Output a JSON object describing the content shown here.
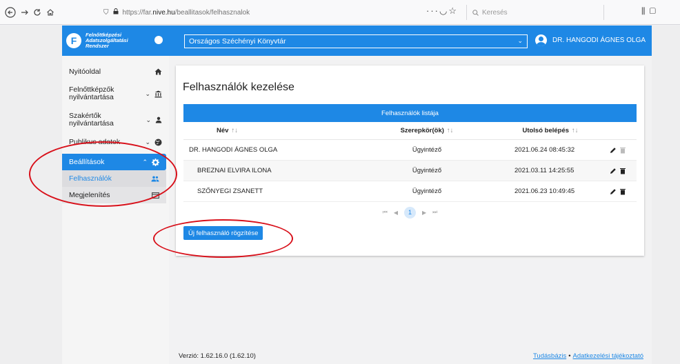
{
  "browser": {
    "url_prefix": "https://far.",
    "url_host": "nive.hu",
    "url_path": "/beallitasok/felhasznalok",
    "search_placeholder": "Keresés"
  },
  "brand": {
    "logo_letter": "F",
    "line1": "Felnőttképzési",
    "line2": "Adatszolgáltatási",
    "line3": "Rendszer"
  },
  "sidebar": {
    "items": [
      {
        "label": "Nyitóoldal"
      },
      {
        "label_line1": "Felnőttképzők",
        "label_line2": "nyilvántartása"
      },
      {
        "label_line1": "Szakértők",
        "label_line2": "nyilvántartása"
      },
      {
        "label": "Publikus adatok"
      },
      {
        "label": "Beállítások"
      }
    ],
    "subitems": [
      {
        "label": "Felhasználók"
      },
      {
        "label": "Megjelenítés"
      }
    ]
  },
  "header": {
    "org": "Országos Széchényi Könyvtár",
    "user": "DR. HANGODI ÁGNES OLGA"
  },
  "main": {
    "title": "Felhasználók kezelése",
    "table_caption": "Felhasználók listája",
    "columns": [
      "Név",
      "Szerepkör(ök)",
      "Utolsó belépés"
    ],
    "sort_glyph": "↑↓",
    "rows": [
      {
        "name": "DR. HANGODI ÁGNES OLGA",
        "role": "Ügyintéző",
        "last_login": "2021.06.24 08:45:32"
      },
      {
        "name": "BREZNAI ELVIRA ILONA",
        "role": "Ügyintéző",
        "last_login": "2021.03.11 14:25:55"
      },
      {
        "name": "SZŐNYEGI ZSANETT",
        "role": "Ügyintéző",
        "last_login": "2021.06.23 10:49:45"
      }
    ],
    "pager": {
      "current_page": "1"
    },
    "new_button": "Új felhasználó rögzítése"
  },
  "footer": {
    "version": "Verzió: 1.62.16.0 (1.62.10)",
    "link1": "Tudásbázis",
    "separator": "•",
    "link2": "Adatkezelési tájékoztató"
  },
  "colors": {
    "primary": "#1e88e5",
    "annotation": "#d8101a"
  }
}
